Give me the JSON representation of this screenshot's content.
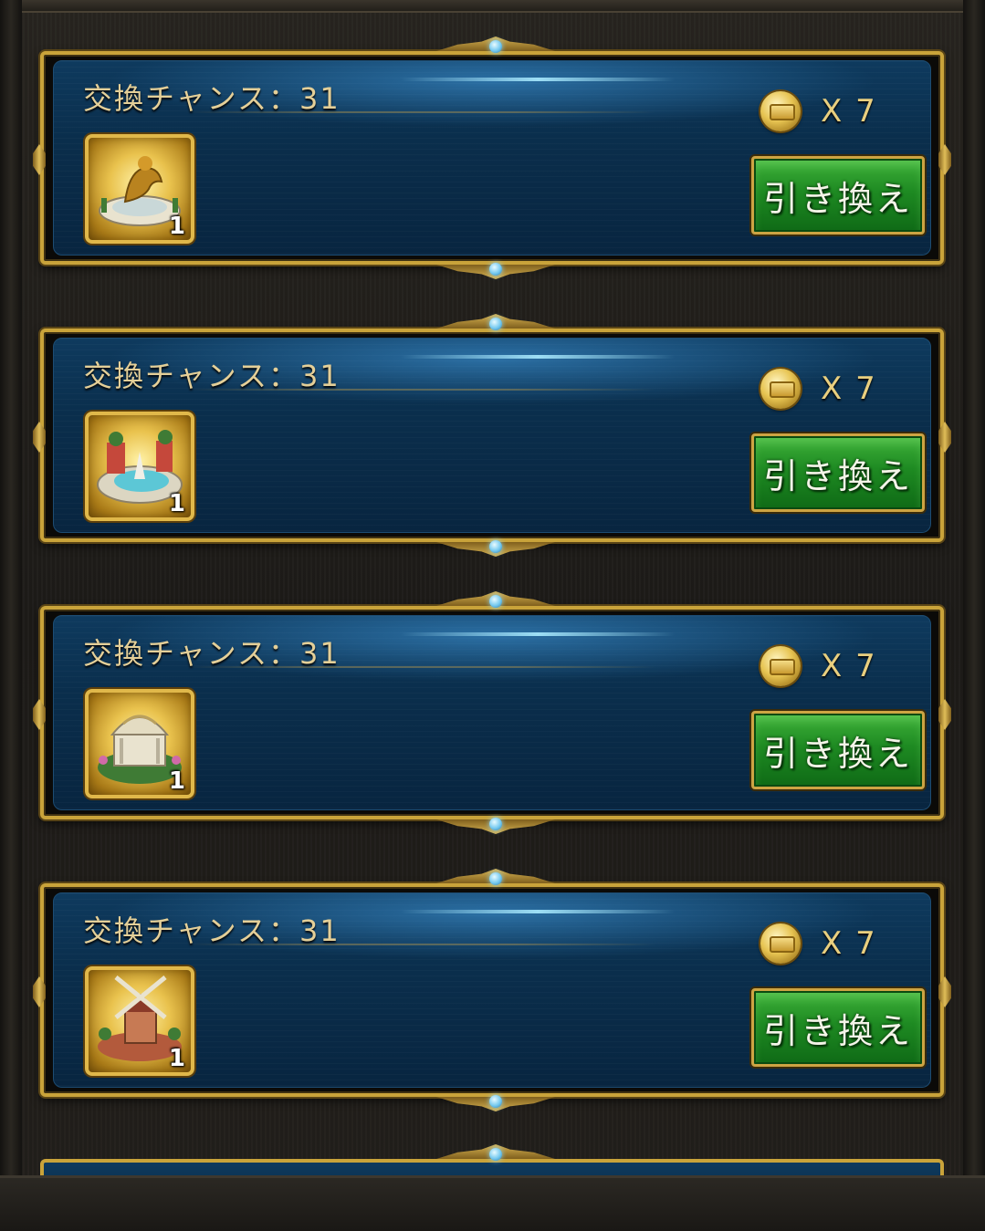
{
  "offers": [
    {
      "title": "交換チャンス：31",
      "cost": "X 7",
      "item_qty": "1",
      "item_icon": "golden-statue-icon",
      "button_label": "引き換え"
    },
    {
      "title": "交換チャンス：31",
      "cost": "X 7",
      "item_qty": "1",
      "item_icon": "fountain-garden-icon",
      "button_label": "引き換え"
    },
    {
      "title": "交換チャンス：31",
      "cost": "X 7",
      "item_qty": "1",
      "item_icon": "domed-pavilion-icon",
      "button_label": "引き換え"
    },
    {
      "title": "交換チャンス：31",
      "cost": "X 7",
      "item_qty": "1",
      "item_icon": "windmill-icon",
      "button_label": "引き換え"
    }
  ],
  "coin_icon": "gold-coin-icon",
  "colors": {
    "frame_gold": "#c9a33a",
    "panel_blue": "#0a2e4c",
    "button_green": "#1e8a22",
    "title_text": "#e4cf98"
  }
}
